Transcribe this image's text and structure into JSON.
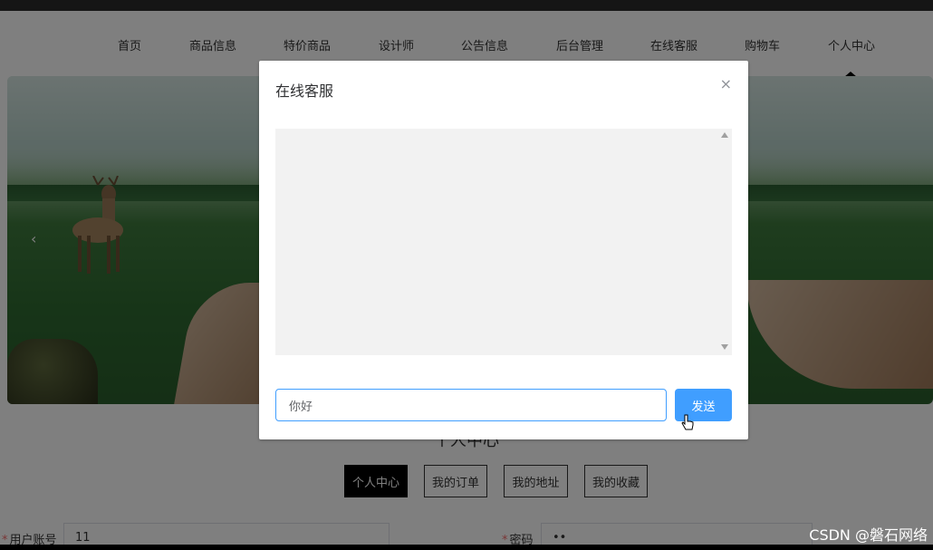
{
  "nav": {
    "items": [
      {
        "label": "首页"
      },
      {
        "label": "商品信息"
      },
      {
        "label": "特价商品"
      },
      {
        "label": "设计师"
      },
      {
        "label": "公告信息"
      },
      {
        "label": "后台管理"
      },
      {
        "label": "在线客服"
      },
      {
        "label": "购物车"
      },
      {
        "label": "个人中心"
      }
    ]
  },
  "banner": {
    "prev_arrow": "‹"
  },
  "personal": {
    "title": "个人中心",
    "tabs": [
      {
        "label": "个人中心"
      },
      {
        "label": "我的订单"
      },
      {
        "label": "我的地址"
      },
      {
        "label": "我的收藏"
      }
    ],
    "fields": [
      {
        "label": "用户账号",
        "value": "11"
      },
      {
        "label": "密码",
        "value": "••"
      }
    ]
  },
  "dialog": {
    "title": "在线客服",
    "close": "×",
    "input_value": "你好",
    "send_label": "发送"
  },
  "watermark": "CSDN @磐石网络",
  "colors": {
    "primary": "#409eff",
    "active_tab": "#000000"
  }
}
